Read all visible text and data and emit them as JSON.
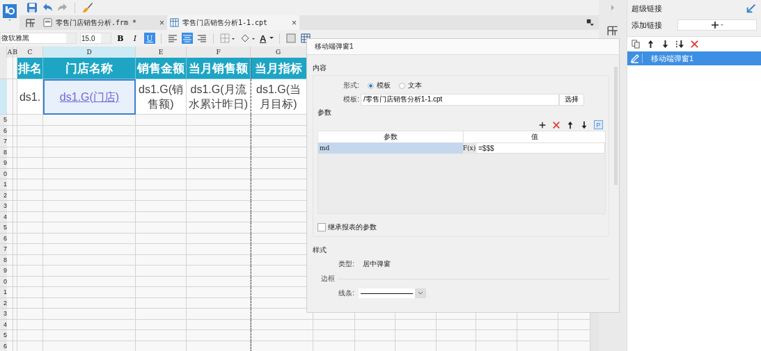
{
  "tabs": [
    {
      "label": "零售门店销售分析.frm *",
      "close": "×",
      "kind": "form",
      "selected": false
    },
    {
      "label": "零售门店销售分析1-1.cpt",
      "close": "×",
      "kind": "report",
      "selected": true
    }
  ],
  "format_bar": {
    "font": "微软雅黑",
    "size": "15.0",
    "styles": [
      {
        "label": "B",
        "kind": "bold",
        "on": false
      },
      {
        "label": "I",
        "kind": "italic",
        "on": false
      },
      {
        "label": "U",
        "kind": "underline",
        "on": true
      }
    ],
    "align": [
      {
        "kind": "left",
        "selected": false
      },
      {
        "kind": "center",
        "selected": true
      },
      {
        "kind": "right",
        "selected": false
      }
    ],
    "font_color": "A"
  },
  "sheet": {
    "columns": [
      {
        "label": "A",
        "selected": false
      },
      {
        "label": "B",
        "selected": false
      },
      {
        "label": "C",
        "selected": false
      },
      {
        "label": "D",
        "selected": true
      },
      {
        "label": "E",
        "selected": false
      },
      {
        "label": "F",
        "selected": false
      },
      {
        "label": "G",
        "selected": false
      }
    ],
    "header_row": [
      "排名",
      "门店名称",
      "销售金额",
      "当月销售额",
      "当月指标"
    ],
    "data_row": [
      {
        "text": "ds1.",
        "kind": "text",
        "selected": false
      },
      {
        "text": "ds1.G(门店)",
        "kind": "link",
        "selected": true
      },
      {
        "text": "ds1.G(销售额)",
        "kind": "text",
        "selected": false
      },
      {
        "text": "ds1.G(月流水累计昨日)",
        "kind": "text",
        "selected": false
      },
      {
        "text": "ds1.G(当月目标)",
        "kind": "text",
        "selected": false
      }
    ],
    "row_labels": [
      "5",
      "6",
      "7",
      "8",
      "9",
      "0",
      "1",
      "2",
      "3",
      "4",
      "5",
      "6",
      "7",
      "8",
      "9",
      "0",
      "1",
      "2",
      "3",
      "4",
      "5",
      "6"
    ]
  },
  "dialog": {
    "title": "移动端弹窗1",
    "content_heading": "内容",
    "form_label": "形式:",
    "form_options": [
      {
        "label": "模板",
        "selected": true
      },
      {
        "label": "文本",
        "selected": false
      }
    ],
    "template_label": "模板:",
    "template_value": "/零售门店销售分析1-1.cpt",
    "choose_button": "选择",
    "params_heading": "参数",
    "param_button": "P",
    "params_table": {
      "columns": [
        "参数",
        "值"
      ],
      "rows": [
        {
          "name": "md",
          "formula": "F(x)",
          "value": "=$$$",
          "selected": true
        }
      ]
    },
    "inherit": {
      "label": "继承报表的参数",
      "checked": false
    },
    "style_heading": "样式",
    "type_label": "类型:",
    "type_value": "居中弹窗",
    "border_heading": "边框",
    "line_label": "线条:"
  },
  "panel": {
    "title": "超级链接",
    "add_label": "添加链接",
    "links": [
      {
        "label": "移动端弹窗1",
        "selected": true
      }
    ]
  }
}
